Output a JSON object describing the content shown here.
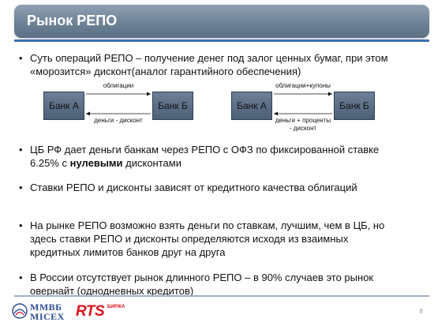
{
  "header": {
    "title": "Рынок РЕПО"
  },
  "bullets": [
    {
      "text": "Суть операций РЕПО – получение денег под залог ценных бумаг, при этом «морозится» дисконт(аналог гарантийного обеспечения)"
    },
    {
      "text_before": "ЦБ РФ дает деньги банкам через РЕПО с ОФЗ по фиксированной ставке 6.25% с ",
      "text_bold": "нулевыми",
      "text_after": " дисконтами"
    },
    {
      "text": "Ставки РЕПО и дисконты зависят от кредитного качества облигаций"
    },
    {
      "text": "На рынке РЕПО возможно взять деньги по ставкам, лучшим, чем в ЦБ, но здесь ставки РЕПО и дисконты определяются исходя из взаимных кредитных лимитов банков друг на друга"
    },
    {
      "text": "В России отсутствует рынок длинного РЕПО – в 90% случаев это рынок овернайт (однодневных кредитов)"
    }
  ],
  "diagram_left": {
    "bank_a": "Банк А",
    "bank_b": "Банк Б",
    "top_label": "облигации",
    "bottom_label": "деньги - дисконт"
  },
  "diagram_right": {
    "bank_a": "Банк А",
    "bank_b": "Банк Б",
    "top_label": "облигации+купоны",
    "bottom_label_line1": "деньги + проценты",
    "bottom_label_line2": "- дисконт"
  },
  "footer": {
    "logo_mmvb_line1": "ММВБ",
    "logo_mmvb_line2": "MICEX",
    "logo_rts": "RTS",
    "logo_rts_sub": "БИРЖА",
    "page_number": "8"
  },
  "colors": {
    "title_bar": "#6e8296",
    "title_underline": "#3f6fb3",
    "bank_box": "#5a6d85",
    "mmvb_blue": "#2f4e96",
    "rts_red": "#d8121c"
  }
}
